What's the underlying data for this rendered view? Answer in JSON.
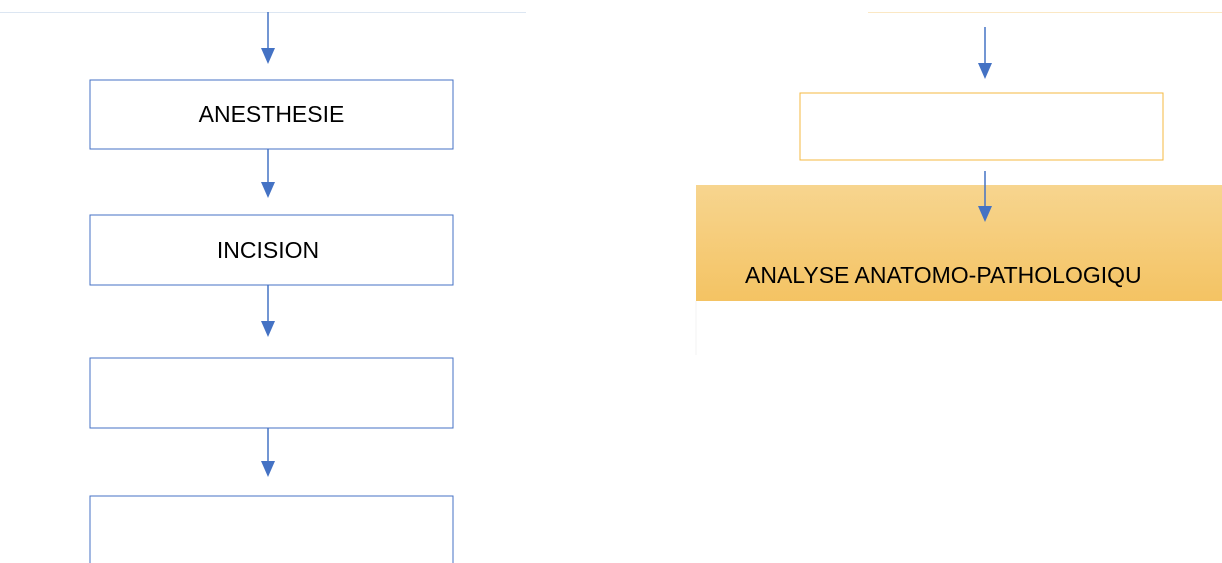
{
  "left_flow": {
    "steps": [
      {
        "label": "ANESTHESIE"
      },
      {
        "label": "INCISION"
      },
      {
        "label": ""
      },
      {
        "label": ""
      }
    ],
    "box_border_color": "#4472c4",
    "arrow_color": "#4472c4"
  },
  "right_flow": {
    "step": {
      "label": ""
    },
    "box_border_color": "#f4b942",
    "arrow_color": "#4472c4",
    "result": {
      "label": "ANALYSE ANATOMO-PATHOLOGIQU",
      "fill_color_top": "#f7d58f",
      "fill_color_bottom": "#f4c363"
    }
  }
}
